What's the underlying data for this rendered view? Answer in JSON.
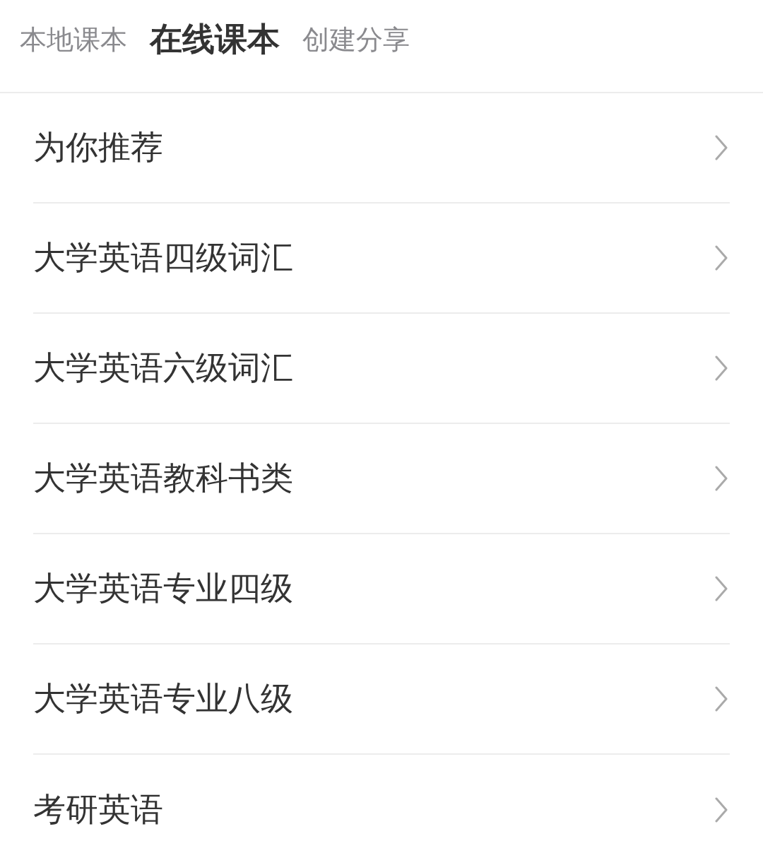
{
  "tabs": [
    {
      "label": "本地课本",
      "selected": false
    },
    {
      "label": "在线课本",
      "selected": true
    },
    {
      "label": "创建分享",
      "selected": false
    }
  ],
  "list": {
    "items": [
      {
        "label": "为你推荐"
      },
      {
        "label": "大学英语四级词汇"
      },
      {
        "label": "大学英语六级词汇"
      },
      {
        "label": "大学英语教科书类"
      },
      {
        "label": "大学英语专业四级"
      },
      {
        "label": "大学英语专业八级"
      },
      {
        "label": "考研英语"
      }
    ]
  }
}
